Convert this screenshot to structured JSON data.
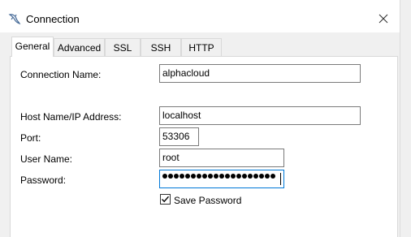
{
  "window": {
    "title": "Connection",
    "app_icon": "dolphin-icon",
    "close_icon": "close-icon"
  },
  "tabs": [
    {
      "label": "General",
      "active": true
    },
    {
      "label": "Advanced",
      "active": false
    },
    {
      "label": "SSL",
      "active": false
    },
    {
      "label": "SSH",
      "active": false
    },
    {
      "label": "HTTP",
      "active": false
    }
  ],
  "form": {
    "connection_name_label": "Connection Name:",
    "connection_name_value": "alphacloud",
    "host_label": "Host Name/IP Address:",
    "host_value": "localhost",
    "port_label": "Port:",
    "port_value": "53306",
    "user_label": "User Name:",
    "user_value": "root",
    "password_label": "Password:",
    "password_mask_count": 20,
    "save_password_label": "Save Password",
    "save_password_checked": true
  },
  "colors": {
    "focus_border": "#0078d7",
    "dialog_background": "#f0f0f0"
  }
}
